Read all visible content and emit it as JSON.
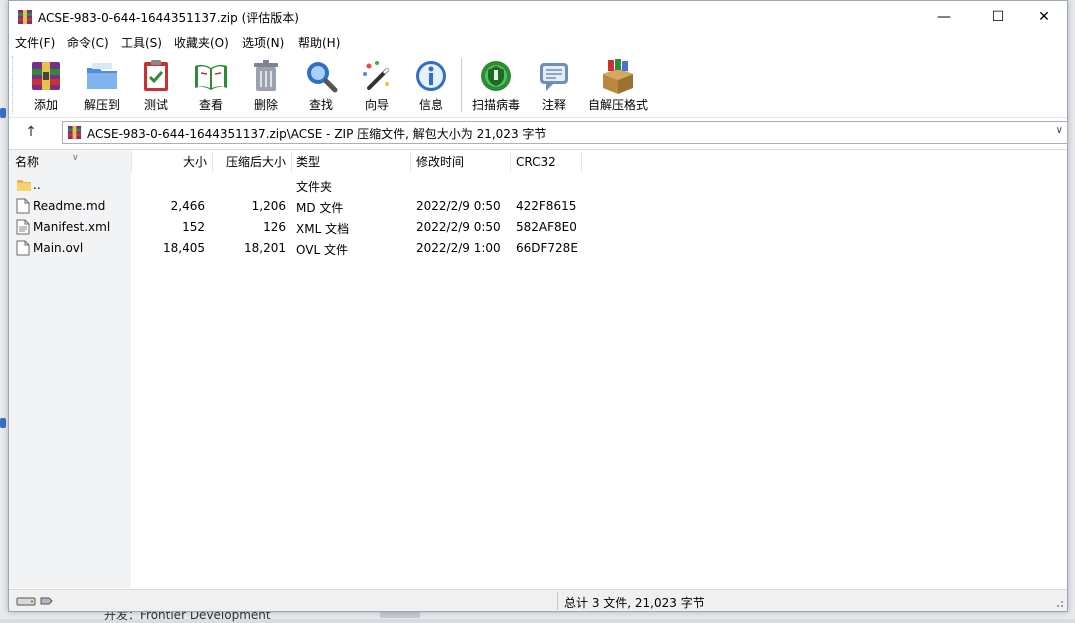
{
  "window": {
    "title": "ACSE-983-0-644-1644351137.zip (评估版本)",
    "minimize_symbol": "—",
    "maximize_symbol": "☐",
    "close_symbol": "✕"
  },
  "menu": [
    "文件(F)",
    "命令(C)",
    "工具(S)",
    "收藏夹(O)",
    "选项(N)",
    "帮助(H)"
  ],
  "toolbar": {
    "buttons": [
      {
        "label": "添加",
        "icon": "add-archive-icon"
      },
      {
        "label": "解压到",
        "icon": "extract-to-icon"
      },
      {
        "label": "测试",
        "icon": "test-icon"
      },
      {
        "label": "查看",
        "icon": "view-icon"
      },
      {
        "label": "删除",
        "icon": "delete-icon"
      },
      {
        "label": "查找",
        "icon": "find-icon"
      },
      {
        "label": "向导",
        "icon": "wizard-icon"
      },
      {
        "label": "信息",
        "icon": "info-icon"
      },
      {
        "label": "扫描病毒",
        "icon": "virus-scan-icon"
      },
      {
        "label": "注释",
        "icon": "comment-icon"
      },
      {
        "label": "自解压格式",
        "icon": "sfx-icon"
      }
    ]
  },
  "address": {
    "up_symbol": "↑",
    "path": "ACSE-983-0-644-1644351137.zip\\ACSE - ZIP 压缩文件, 解包大小为 21,023 字节",
    "dropdown_symbol": "∨"
  },
  "file_list": {
    "sort_caret": "∨",
    "columns": [
      "名称",
      "大小",
      "压缩后大小",
      "类型",
      "修改时间",
      "CRC32"
    ],
    "rows": [
      {
        "name": "..",
        "size": "",
        "packed": "",
        "type": "文件夹",
        "modified": "",
        "crc": "",
        "icon": "folder-icon"
      },
      {
        "name": "Readme.md",
        "size": "2,466",
        "packed": "1,206",
        "type": "MD 文件",
        "modified": "2022/2/9 0:50",
        "crc": "422F8615",
        "icon": "file-icon"
      },
      {
        "name": "Manifest.xml",
        "size": "152",
        "packed": "126",
        "type": "XML 文档",
        "modified": "2022/2/9 0:50",
        "crc": "582AF8E0",
        "icon": "xml-file-icon"
      },
      {
        "name": "Main.ovl",
        "size": "18,405",
        "packed": "18,201",
        "type": "OVL 文件",
        "modified": "2022/2/9 1:00",
        "crc": "66DF728E",
        "icon": "file-icon"
      }
    ]
  },
  "status": {
    "summary": "总计 3 文件, 21,023 字节"
  },
  "background": {
    "text": "开发：Frontier Development"
  }
}
